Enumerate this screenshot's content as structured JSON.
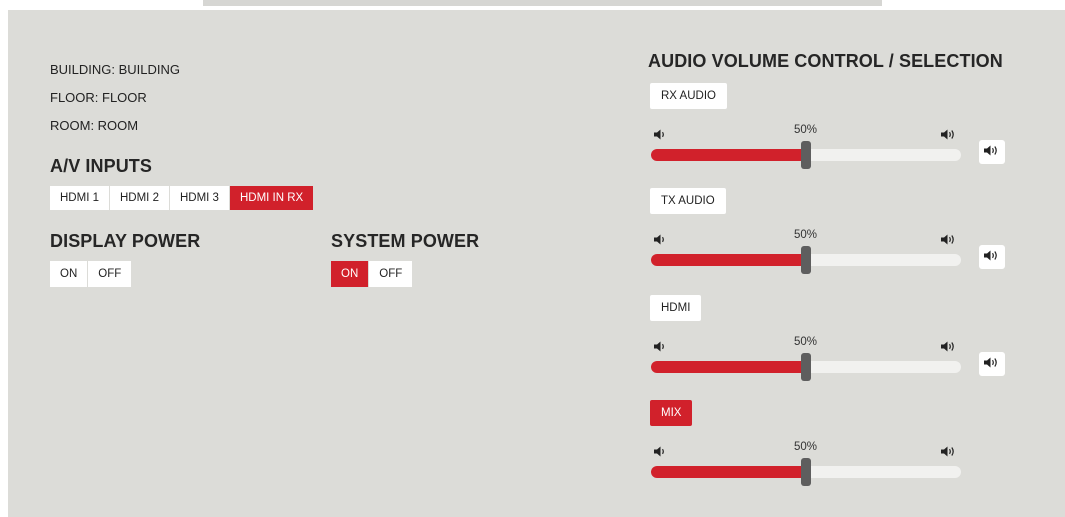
{
  "location": {
    "building": "BUILDING: BUILDING",
    "floor": "FLOOR: FLOOR",
    "room": "ROOM: ROOM"
  },
  "av_inputs": {
    "heading": "A/V INPUTS",
    "options": [
      "HDMI 1",
      "HDMI 2",
      "HDMI 3",
      "HDMI IN RX"
    ],
    "selected": "HDMI IN RX"
  },
  "display_power": {
    "heading": "DISPLAY POWER",
    "on_label": "ON",
    "off_label": "OFF",
    "state": "none"
  },
  "system_power": {
    "heading": "SYSTEM POWER",
    "on_label": "ON",
    "off_label": "OFF",
    "state": "ON"
  },
  "audio": {
    "heading": "AUDIO VOLUME CONTROL / SELECTION",
    "channels": [
      {
        "label": "RX AUDIO",
        "selected": false,
        "volume_text": "50%",
        "volume": 0.5,
        "has_mute": true
      },
      {
        "label": "TX AUDIO",
        "selected": false,
        "volume_text": "50%",
        "volume": 0.5,
        "has_mute": true
      },
      {
        "label": "HDMI",
        "selected": false,
        "volume_text": "50%",
        "volume": 0.5,
        "has_mute": true
      },
      {
        "label": "MIX",
        "selected": true,
        "volume_text": "50%",
        "volume": 0.5,
        "has_mute": false
      }
    ]
  },
  "colors": {
    "accent": "#d1212b",
    "panel": "#dcdcd8",
    "slider_thumb": "#5e5e5e"
  },
  "icons": [
    "speaker-low-icon",
    "speaker-high-icon"
  ]
}
